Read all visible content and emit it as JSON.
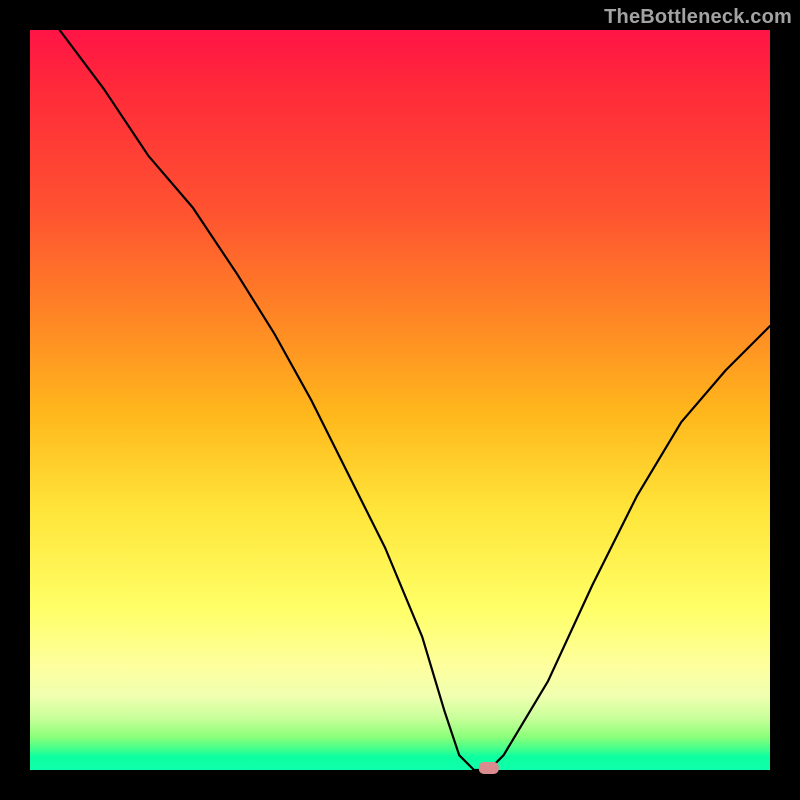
{
  "watermark": "TheBottleneck.com",
  "chart_data": {
    "type": "line",
    "title": "",
    "xlabel": "",
    "ylabel": "",
    "xlim": [
      0,
      100
    ],
    "ylim": [
      0,
      100
    ],
    "grid": false,
    "legend": false,
    "series": [
      {
        "name": "bottleneck-curve",
        "x": [
          4,
          10,
          16,
          22,
          28,
          33,
          38,
          43,
          48,
          53,
          56,
          58,
          60,
          62,
          64,
          70,
          76,
          82,
          88,
          94,
          100
        ],
        "y": [
          100,
          92,
          83,
          76,
          67,
          59,
          50,
          40,
          30,
          18,
          8,
          2,
          0,
          0,
          2,
          12,
          25,
          37,
          47,
          54,
          60
        ]
      }
    ],
    "marker": {
      "x": 62,
      "y": 0,
      "color": "#da8b8d",
      "shape": "rounded-rect"
    },
    "background_gradient": {
      "top": "#ff1446",
      "mid1": "#ff8a24",
      "mid2": "#ffff66",
      "bottom": "#0effac"
    }
  }
}
